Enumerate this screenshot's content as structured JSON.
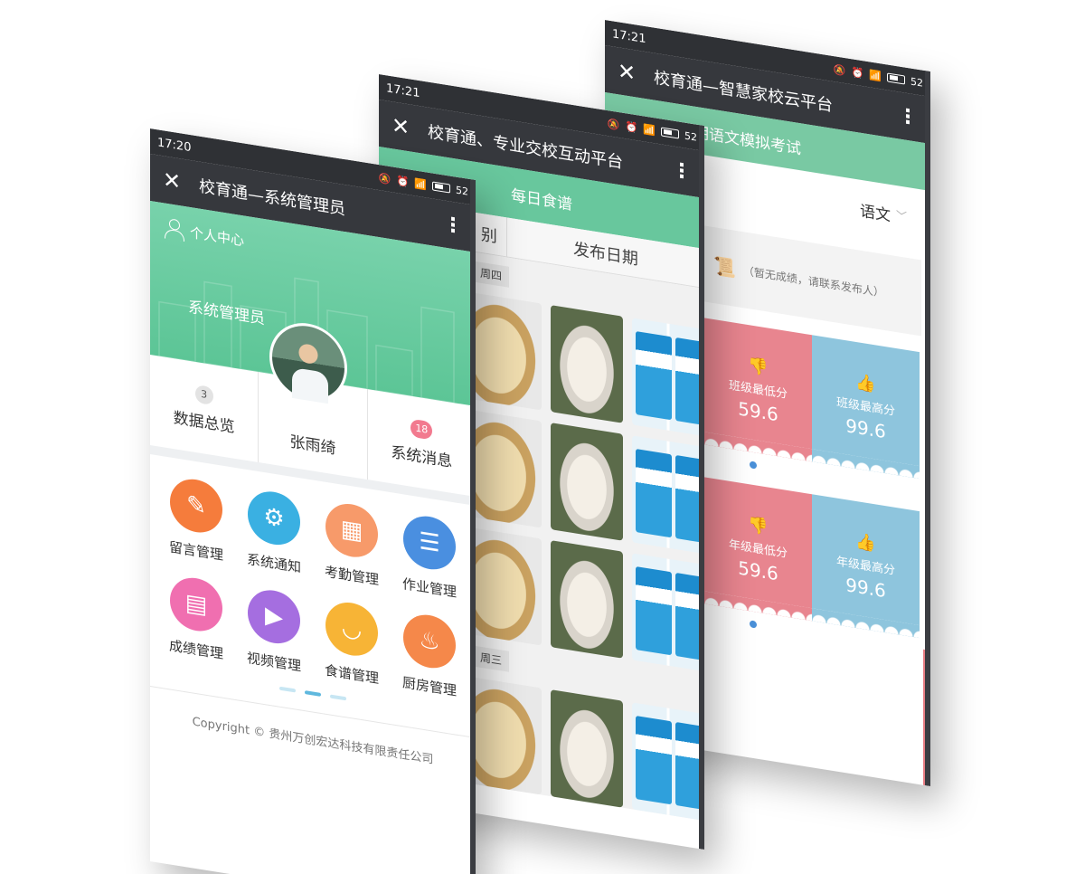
{
  "phone3": {
    "time": "17:21",
    "battery": "52",
    "title": "校育通—智慧家校云平台",
    "header": "年度上学期语文模拟考试",
    "subject": "语文",
    "empty_msg": "（暂无成绩，请联系发布人）",
    "rows": [
      {
        "low_label": "班级最低分",
        "low": "59.6",
        "high_label": "班级最高分",
        "high": "99.6"
      },
      {
        "low_label": "年级最低分",
        "low": "59.6",
        "high_label": "年级最高分",
        "high": "99.6"
      }
    ]
  },
  "phone2": {
    "time": "17:21",
    "battery": "52",
    "title": "校育通、专业交校互动平台",
    "header": "每日食谱",
    "tab_left": "别",
    "tab_right": "发布日期",
    "day1": "周四",
    "day2": "周三"
  },
  "phone1": {
    "time": "17:20",
    "battery": "52",
    "title": "校育通—系统管理员",
    "personal_center": "个人中心",
    "role": "系统管理员",
    "name": "张雨绮",
    "stats": [
      {
        "badge": "3",
        "label": "数据总览"
      },
      {
        "badge": "",
        "label": "张雨绮"
      },
      {
        "badge": "18",
        "label": "系统消息"
      }
    ],
    "menu": [
      {
        "label": "留言管理",
        "icon": "pencil-icon",
        "color": "#f57c3c"
      },
      {
        "label": "系统通知",
        "icon": "gear-icon",
        "color": "#3ab0e2"
      },
      {
        "label": "考勤管理",
        "icon": "calendar-icon",
        "color": "#f79a6a"
      },
      {
        "label": "作业管理",
        "icon": "checklist-icon",
        "color": "#4a8fe0"
      },
      {
        "label": "成绩管理",
        "icon": "certificate-icon",
        "color": "#f06fb0"
      },
      {
        "label": "视频管理",
        "icon": "play-icon",
        "color": "#a56ee0"
      },
      {
        "label": "食谱管理",
        "icon": "bowl-icon",
        "color": "#f7b436"
      },
      {
        "label": "厨房管理",
        "icon": "chef-icon",
        "color": "#f5884a"
      }
    ],
    "copyright": "Copyright © 贵州万创宏达科技有限责任公司"
  }
}
